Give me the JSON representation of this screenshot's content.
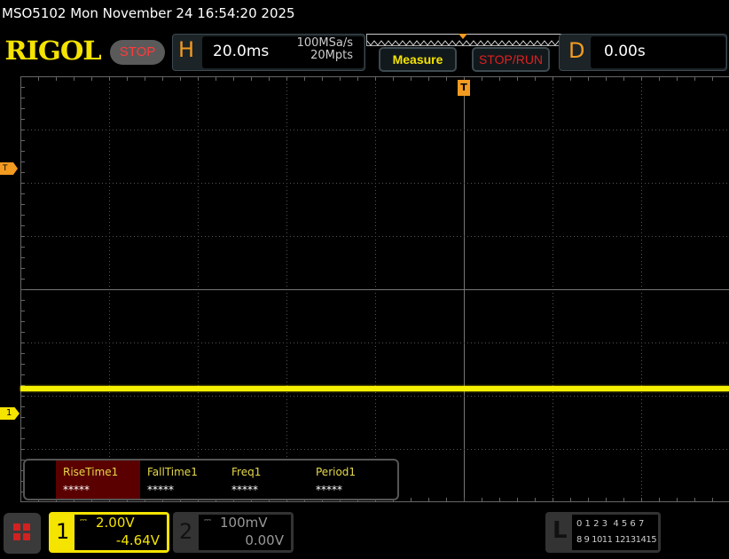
{
  "title_bar": "MSO5102  Mon November 24 16:54:20 2025",
  "logo": "RIGOL",
  "run_state": "STOP",
  "horizontal": {
    "label": "H",
    "timebase": "20.0ms",
    "sample_rate": "100MSa/s",
    "memory_depth": "20Mpts"
  },
  "buttons": {
    "measure": "Measure",
    "stop_run": "STOP/RUN"
  },
  "delay": {
    "label": "D",
    "value": "0.00s"
  },
  "trigger": {
    "top_marker": "T",
    "level_marker": "T"
  },
  "ch1_marker": "1",
  "measurements": [
    {
      "label": "RiseTime1",
      "value": "*****",
      "selected": true
    },
    {
      "label": "FallTime1",
      "value": "*****"
    },
    {
      "label": "Freq1",
      "value": "*****"
    },
    {
      "label": "Period1",
      "value": "*****"
    }
  ],
  "channels": [
    {
      "num": "1",
      "scale": "2.00V",
      "offset": "-4.64V",
      "coupling_icon": "dc-coupling-icon",
      "color": "#f5e300"
    },
    {
      "num": "2",
      "scale": "100mV",
      "offset": "0.00V",
      "coupling_icon": "dc-coupling-icon",
      "color": "#888888"
    }
  ],
  "logic": {
    "label": "L",
    "row1": "0 1 2 3  4 5 6 7",
    "row2": "8 9 1011 12131415"
  }
}
